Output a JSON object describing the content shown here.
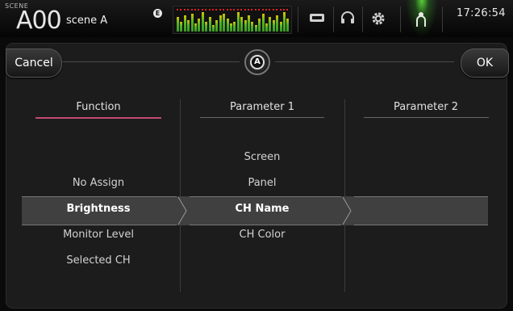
{
  "status_bar": {
    "scene_label": "SCENE",
    "scene_number": "A00",
    "scene_name": "scene A",
    "edit_indicator": "E",
    "clock": "17:26:54",
    "icons": [
      "level-meter",
      "recorder-icon",
      "headphones-icon",
      "gear-icon",
      "user-icon"
    ]
  },
  "dialog": {
    "cancel_label": "Cancel",
    "ok_label": "OK",
    "center_knob_label": "A",
    "columns": [
      {
        "header": "Function",
        "items": [
          "No Assign",
          "Brightness",
          "Monitor Level",
          "Selected CH"
        ],
        "selected": "Brightness"
      },
      {
        "header": "Parameter 1",
        "items": [
          "Screen",
          "Panel",
          "CH Name",
          "CH Color"
        ],
        "selected": "CH Name"
      },
      {
        "header": "Parameter 2",
        "items": [],
        "selected": ""
      }
    ]
  },
  "colors": {
    "background": "#0a0a0a",
    "panel": "#1c1c1c",
    "selection_band": "#404040",
    "active_underline": "#c24a72",
    "meter_green": "#50b42a",
    "meter_yellow": "#d6c400",
    "user_glow": "#5bd03a"
  }
}
